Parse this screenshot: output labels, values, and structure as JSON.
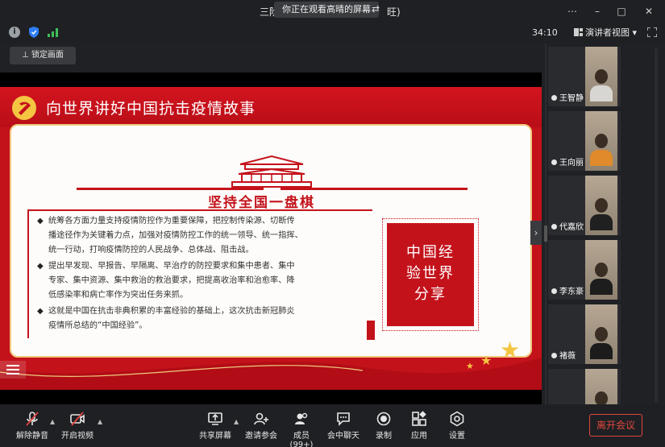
{
  "window": {
    "title_left": "三阶",
    "title_right": "旺)",
    "share_tip": "你正在观看高晴的屏幕",
    "share_tip_icon": "⇄",
    "minimize": "–",
    "maximize": "□",
    "close": "✕",
    "more": "⋯"
  },
  "infobar": {
    "info_label": "i",
    "timer": "34:10",
    "view_mode": "演讲者视图 ▾"
  },
  "lock_button": "锁定画面",
  "slide": {
    "title": "向世界讲好中国抗击疫情故事",
    "section_title": "坚持全国一盘棋",
    "bullets": [
      [
        "统筹各方面力量支持疫情防控作为重要保障，把控制传染源、切断传",
        "播途径作为关键着力点，加强对疫情防控工作的统一领导、统一指挥、",
        "统一行动，打响疫情防控的人民战争、总体战、阻击战。"
      ],
      [
        "提出早发现、早报告、早隔离、早治疗的防控要求和集中患者、集中",
        "专家、集中资源、集中救治的救治要求，把提高收治率和治愈率、降",
        "低感染率和病亡率作为突出任务来抓。"
      ],
      [
        "这就是中国在抗击非典积累的丰富经验的基础上，这次抗击新冠肺炎",
        "疫情所总结的“中国经验”。"
      ]
    ],
    "bullet_glyph": "◆",
    "box_lines": [
      "中国经",
      "验世界",
      "分享"
    ],
    "next_glyph": "›"
  },
  "participants": [
    {
      "name": "王智静",
      "shirt": "#d8d6d2"
    },
    {
      "name": "王向丽",
      "shirt": "#e08a2c"
    },
    {
      "name": "代嘉欣",
      "shirt": "#202020"
    },
    {
      "name": "李东豪",
      "shirt": "#1d1d1d"
    },
    {
      "name": "褚薇",
      "shirt": "#1c1c1c"
    },
    {
      "name": "",
      "shirt": "#d9d2c6"
    }
  ],
  "toolbar": {
    "mute": "解除静音",
    "video": "开启视频",
    "share": "共享屏幕",
    "invite": "邀请参会",
    "members": "成员(99+)",
    "chat": "会中聊天",
    "record": "录制",
    "apps": "应用",
    "settings": "设置",
    "leave": "离开会议",
    "caret": "▲"
  },
  "colors": {
    "accent_red": "#c4121b",
    "gold": "#f4c542",
    "leave_red": "#e0463f"
  }
}
